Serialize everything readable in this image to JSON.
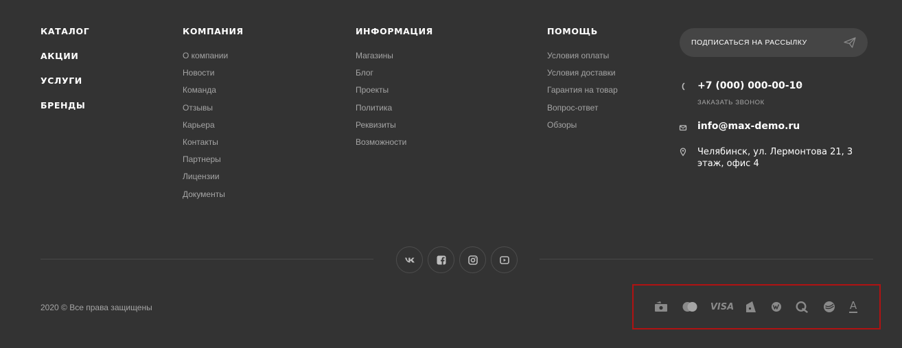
{
  "main_nav": {
    "items": [
      "КАТАЛОГ",
      "АКЦИИ",
      "УСЛУГИ",
      "БРЕНДЫ"
    ]
  },
  "company": {
    "title": "КОМПАНИЯ",
    "links": [
      "О компании",
      "Новости",
      "Команда",
      "Отзывы",
      "Карьера",
      "Контакты",
      "Партнеры",
      "Лицензии",
      "Документы"
    ]
  },
  "info": {
    "title": "ИНФОРМАЦИЯ",
    "links": [
      "Магазины",
      "Блог",
      "Проекты",
      "Политика",
      "Реквизиты",
      "Возможности"
    ]
  },
  "help": {
    "title": "ПОМОЩЬ",
    "links": [
      "Условия оплаты",
      "Условия доставки",
      "Гарантия на товар",
      "Вопрос-ответ",
      "Обзоры"
    ]
  },
  "subscribe": {
    "label": "ПОДПИСАТЬСЯ НА РАССЫЛКУ",
    "icon": "paper-plane-icon"
  },
  "contacts": {
    "phone": "+7 (000) 000-00-10",
    "callback": "ЗАКАЗАТЬ ЗВОНОК",
    "email": "info@max-demo.ru",
    "address": "Челябинск, ул. Лермонтова 21, 3 этаж, офис 4"
  },
  "social": [
    "vk-icon",
    "facebook-icon",
    "instagram-icon",
    "youtube-icon"
  ],
  "footer": {
    "copyright": "2020 © Все права защищены"
  },
  "payments": {
    "icons": [
      "cash-icon",
      "mastercard-icon",
      "visa-icon",
      "yandex-money-icon",
      "webmoney-icon",
      "qiwi-icon",
      "sberbank-icon",
      "alfa-bank-icon"
    ],
    "visa_text": "VISA",
    "alfa_text": "A",
    "highlight_color": "#b11212"
  },
  "colors": {
    "background": "#333333",
    "muted_text": "#a5a5a5",
    "text": "#ffffff"
  }
}
